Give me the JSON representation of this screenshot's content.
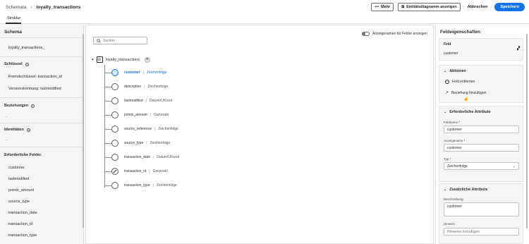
{
  "breadcrumb": {
    "root": "Schemata",
    "separator": "›",
    "current": "loyalty_transactions"
  },
  "toolbar": {
    "more_label": "Mehr",
    "diagram_label": "Entitätsdiagramm anzeigen",
    "cancel_label": "Abbrechen",
    "save_label": "Speichern"
  },
  "tabs": [
    {
      "label": "Struktur",
      "active": true
    }
  ],
  "left_panel": {
    "schema_title": "Schema",
    "schema_name": "loyalty_transactions_",
    "keys_title": "Schlüssel",
    "foreign_key": "Fremdschlüssel: transaction_id",
    "version_key": "Versionskennung: lastmodified",
    "relations_title": "Beziehungen",
    "relations_empty": "-",
    "identities_title": "Identitäten",
    "identities_empty": "-",
    "required_title": "Erforderliche Felder",
    "required_fields": [
      "customer",
      "lastmodified",
      "points_amount",
      "source_type",
      "transaction_date",
      "transaction_id",
      "transaction_type"
    ]
  },
  "canvas": {
    "search_placeholder": "Suchen",
    "toggle_label": "Anzeigenamen für Felder anzeigen",
    "root_label": "loyalty_transactions",
    "fields": [
      {
        "name": "customer",
        "type": "Zeichenfolge",
        "selected": true,
        "icon": "circle"
      },
      {
        "name": "description",
        "type": "Zeichenfolge",
        "icon": "circle"
      },
      {
        "name": "lastmodified",
        "type": "Datum/Uhrzeit",
        "icon": "circle"
      },
      {
        "name": "points_amount",
        "type": "Ganzzahl",
        "icon": "circle"
      },
      {
        "name": "source_reference",
        "type": "Zeichenfolge",
        "icon": "circle"
      },
      {
        "name": "source_type",
        "type": "Zeichenfolge",
        "icon": "circle"
      },
      {
        "name": "transaction_date",
        "type": "Datum/Uhrzeit",
        "icon": "circle"
      },
      {
        "name": "transaction_id",
        "type": "Ganzzahl",
        "icon": "link-icon"
      },
      {
        "name": "transaction_type",
        "type": "Zeichenfolge",
        "icon": "circle"
      }
    ]
  },
  "right_panel": {
    "title": "Feldeigenschaften",
    "field_label": "Feld",
    "field_value": "customer",
    "actions_title": "Aktionen",
    "remove_field": "Feld entfernen",
    "add_relation": "Beziehung hinzufügen",
    "required_attrs_title": "Erforderliche Attribute",
    "field_name_label": "Feldname",
    "field_name_value": "customer",
    "display_name_label": "Anzeigename",
    "display_name_value": "customer",
    "type_label": "Typ",
    "type_value": "Zeichenfolge",
    "required_marker": "*",
    "extra_attrs_title": "Zusätzliche Attribute",
    "description_label": "Beschreibung",
    "description_value": "customer",
    "hint_label": "Hinweis",
    "hint_placeholder": "Hinweise hinzufügen"
  },
  "colors": {
    "accent": "#1473e6",
    "selected_fill": "#d3e5fb"
  }
}
